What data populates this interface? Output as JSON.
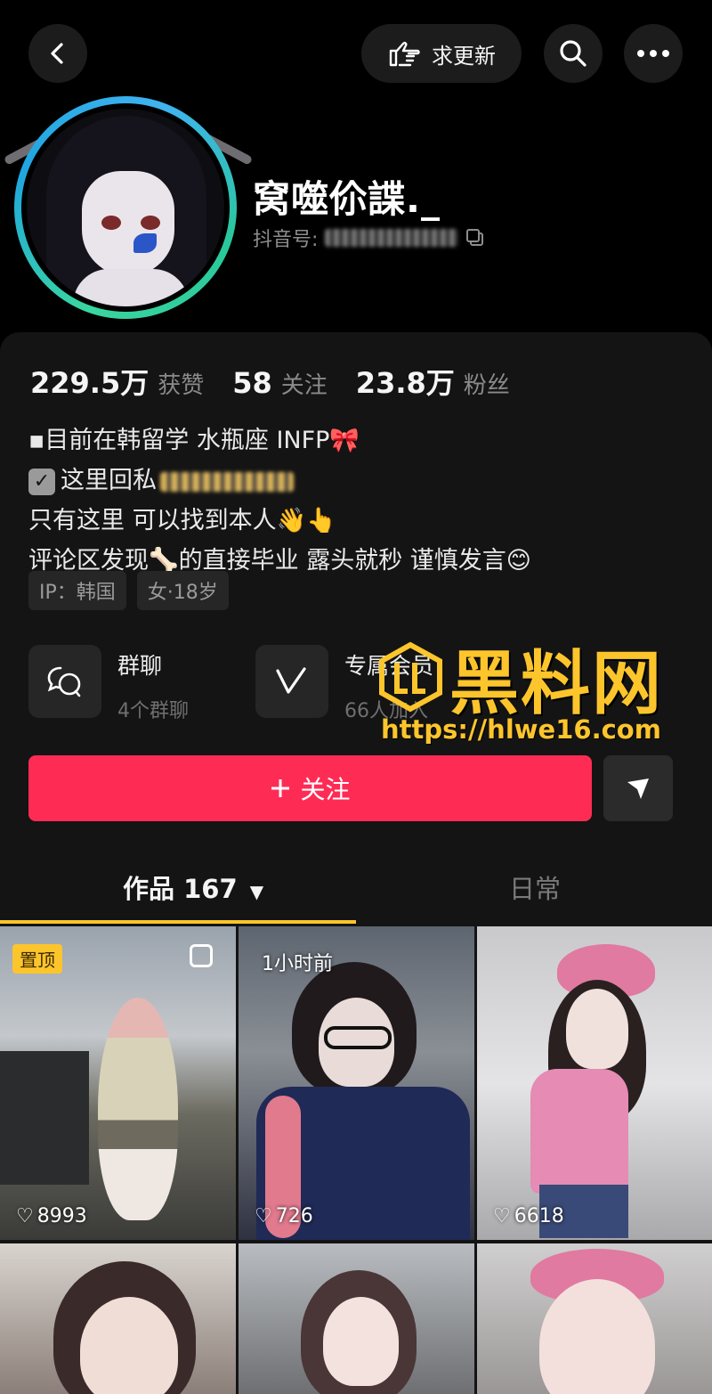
{
  "topbar": {
    "update_label": "求更新"
  },
  "profile": {
    "username": "窝噬伱諜._",
    "id_label": "抖音号:"
  },
  "stats": [
    {
      "value": "229.5万",
      "label": "获赞"
    },
    {
      "value": "58",
      "label": "关注"
    },
    {
      "value": "23.8万",
      "label": "粉丝"
    }
  ],
  "bio": {
    "line1": "▪目前在韩留学 水瓶座 INFP🎀",
    "line2": "这里回私",
    "line3": "只有这里 可以找到本人👋👆",
    "line4": "评论区发现🦴的直接毕业 露头就秒 谨慎发言😊"
  },
  "tags": {
    "ip": "IP：韩国",
    "gender_age": "女·18岁"
  },
  "features": {
    "group_title": "群聊",
    "group_sub": "4个群聊",
    "member_title": "专属会员",
    "member_sub": "66人加入"
  },
  "actions": {
    "follow_label": "关注"
  },
  "tabs": {
    "works_label": "作品 167",
    "daily_label": "日常"
  },
  "posts": [
    {
      "badge": "置顶",
      "likes": "8993"
    },
    {
      "time": "1小时前",
      "likes": "726"
    },
    {
      "likes": "6618"
    }
  ],
  "watermark": {
    "title": "黑料网",
    "url": "https://hlwe16.com"
  },
  "colors": {
    "accent": "#fe2c55",
    "tab_indicator": "#fdc52c",
    "background": "#000000",
    "card": "#141414"
  }
}
